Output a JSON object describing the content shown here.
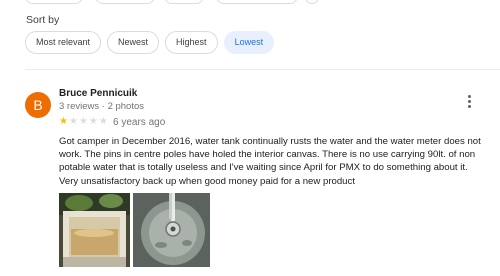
{
  "sort": {
    "label": "Sort by",
    "options": [
      {
        "label": "Most relevant",
        "selected": false
      },
      {
        "label": "Newest",
        "selected": false
      },
      {
        "label": "Highest",
        "selected": false
      },
      {
        "label": "Lowest",
        "selected": true
      }
    ]
  },
  "review": {
    "avatar_letter": "B",
    "avatar_color": "#ef6c00",
    "name": "Bruce Pennicuik",
    "meta": "3 reviews · 2 photos",
    "rating": 1,
    "rating_max": 5,
    "age": "6 years ago",
    "text": "Got camper in December 2016, water tank continually rusts the water and the water meter does not work.   The pins in centre poles have holed the interior canvas.   There is no use carrying 90lt. of non potable water that is totally useless and I've waiting since April for PMX to do something about it.   Very unsatisfactory back up when good money paid for a new product",
    "photos": [
      {
        "name": "review-photo-water-tank"
      },
      {
        "name": "review-photo-sink-drain"
      }
    ]
  },
  "colors": {
    "accent": "#1a73e8",
    "selected_chip_bg": "#e8f0fe",
    "star": "#fbbc04"
  },
  "icons": {
    "more": "more-vert-icon",
    "star": "star-icon"
  }
}
